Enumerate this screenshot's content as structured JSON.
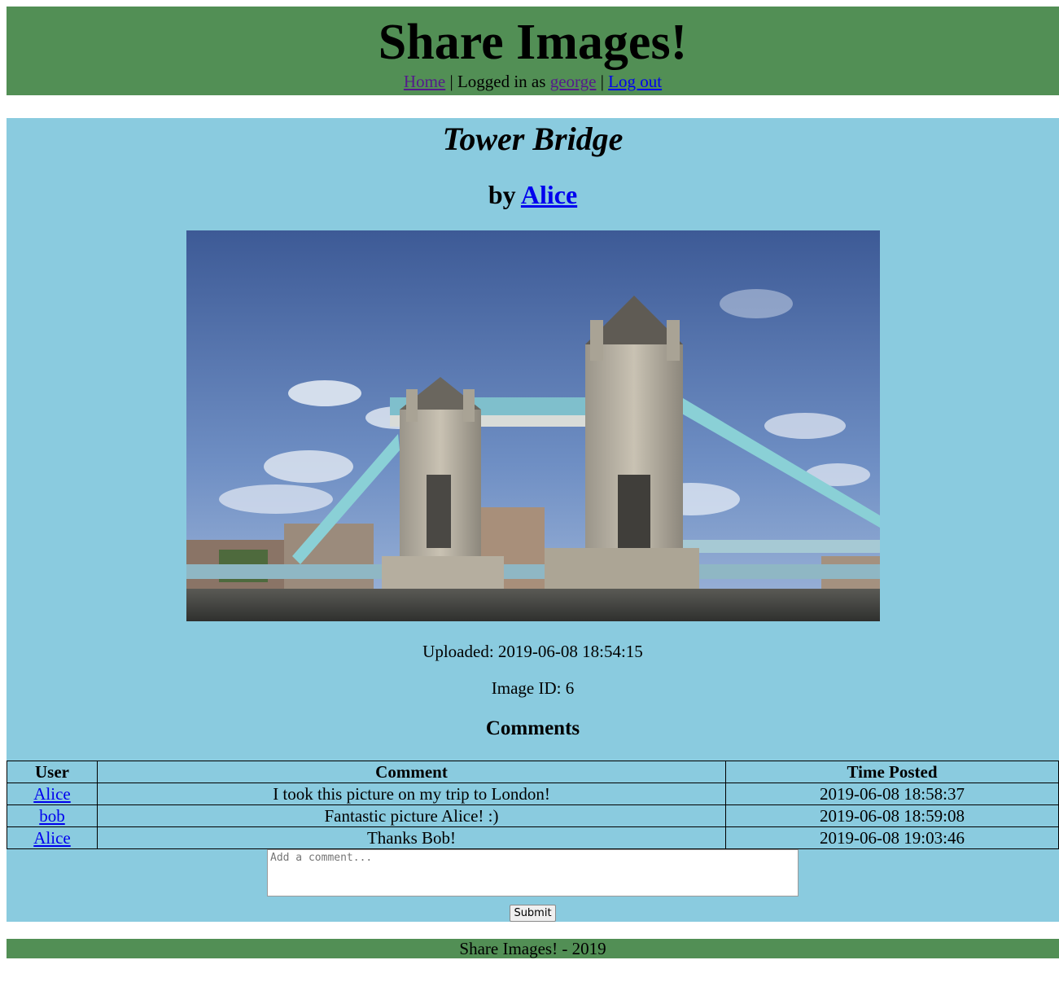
{
  "header": {
    "site_title": "Share Images!",
    "nav": {
      "home_label": "Home",
      "sep1": " | ",
      "logged_in_prefix": "Logged in as ",
      "username": "george",
      "sep2": " | ",
      "logout_label": "Log out"
    }
  },
  "image": {
    "title": "Tower Bridge",
    "by_prefix": "by ",
    "author": "Alice",
    "uploaded_label": "Uploaded: ",
    "uploaded_value": "2019-06-08 18:54:15",
    "id_label": "Image ID: ",
    "id_value": "6"
  },
  "comments": {
    "heading": "Comments",
    "columns": [
      "User",
      "Comment",
      "Time Posted"
    ],
    "rows": [
      {
        "user": "Alice",
        "comment": "I took this picture on my trip to London!",
        "time": "2019-06-08 18:58:37"
      },
      {
        "user": "bob",
        "comment": "Fantastic picture Alice! :)",
        "time": "2019-06-08 18:59:08"
      },
      {
        "user": "Alice",
        "comment": "Thanks Bob!",
        "time": "2019-06-08 19:03:46"
      }
    ],
    "input_placeholder": "Add a comment...",
    "submit_label": "Submit"
  },
  "footer": {
    "text": "Share Images! - 2019"
  },
  "colors": {
    "header_bg": "#528f55",
    "main_bg": "#8acbdf",
    "link": "#0000ee",
    "visited_link": "#551a8b"
  }
}
